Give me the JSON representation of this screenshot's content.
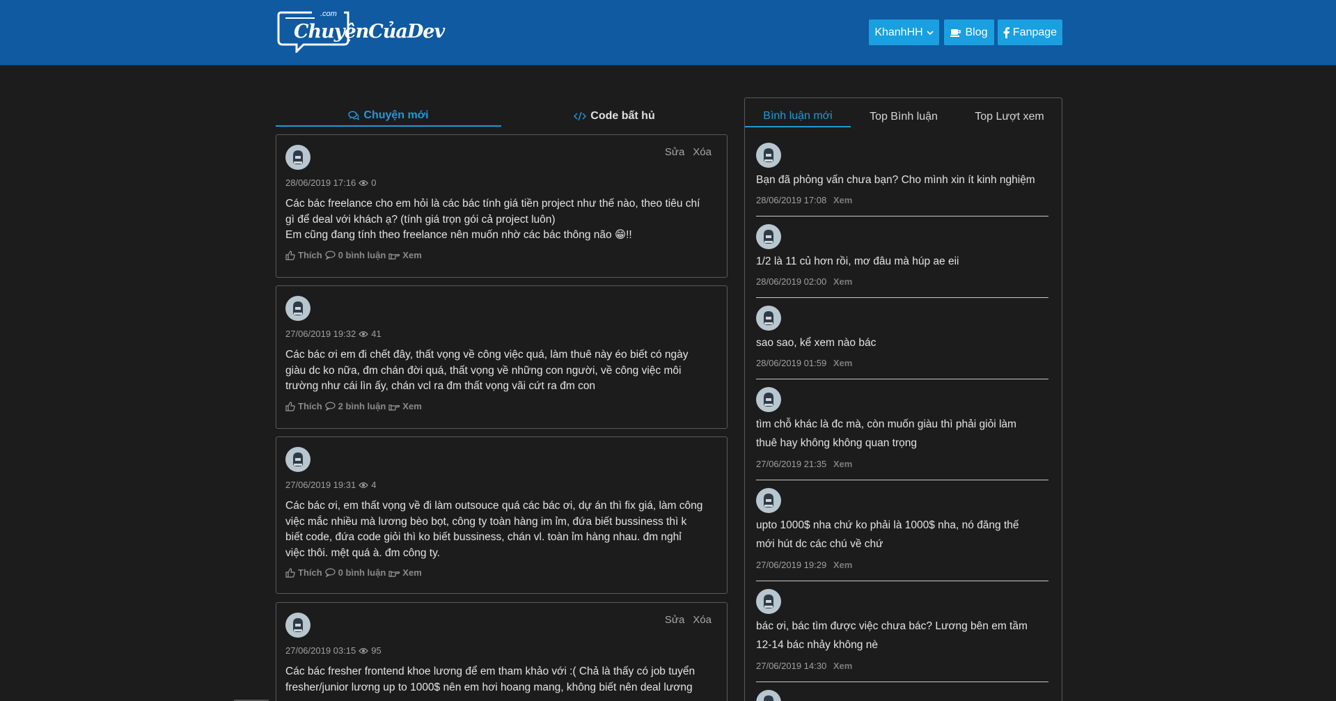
{
  "header": {
    "logo_com": ".com",
    "logo_text": "ChuyệnCủaDev",
    "user_label": "KhanhHH",
    "blog_label": "Blog",
    "fanpage_label": "Fanpage",
    "colors": {
      "bar": "#0f5aa0",
      "button": "#1aa0e0"
    }
  },
  "left_tabs": [
    {
      "label": "Chuyện mới",
      "icon": "comments-icon",
      "active": true
    },
    {
      "label": "Code bất hủ",
      "icon": "code-icon",
      "active": false
    }
  ],
  "posts": [
    {
      "edit": "Sửa",
      "delete": "Xóa",
      "time": "28/06/2019 17:16",
      "views": "0",
      "lines": [
        "Các bác freelance cho em hỏi là các bác tính giá tiền project như thế nào, theo tiêu chí",
        "gì để deal với khách ạ? (tính giá trọn gói cả project luôn)",
        "Em cũng đang tính theo freelance nên muốn nhờ các bác thông não 😁!!"
      ],
      "like": "Thích",
      "comments": "0 bình luận",
      "view_link": "Xem"
    },
    {
      "time": "27/06/2019 19:32",
      "views": "41",
      "lines": [
        "Các bác ơi em đi chết đây, thất vọng về công việc quá, làm thuê này éo biết có ngày",
        "giàu dc ko nữa, đm chán đời quá, thất vọng về những con người, về công việc môi",
        "trường như cái lìn ấy, chán vcl ra đm thất vọng vãi cứt ra đm con"
      ],
      "like": "Thích",
      "comments": "2 bình luận",
      "view_link": "Xem"
    },
    {
      "time": "27/06/2019 19:31",
      "views": "4",
      "lines": [
        "Các bác ơi, em thất vọng về đi làm outsouce quá các bác ơi, dự án thì fix giá, làm công",
        "việc mắc nhiều mà lương bèo bọt, công ty toàn hàng im ỉm, đứa biết bussiness thì k",
        "biết code, đứa code giỏi thì ko biết bussiness, chán vl. toàn ỉm hàng nhau. đm nghỉ",
        "việc thôi. mệt quá à. đm công ty."
      ],
      "like": "Thích",
      "comments": "0 bình luận",
      "view_link": "Xem"
    },
    {
      "edit": "Sửa",
      "delete": "Xóa",
      "time": "27/06/2019 03:15",
      "views": "95",
      "lines": [
        "Các bác fresher frontend khoe lương để em tham khảo với :( Chả là thấy có job tuyển",
        "fresher/junior lương up to 1000$ nên em hơi hoang mang, không biết nên deal lương"
      ]
    }
  ],
  "right_tabs": [
    "Bình luận mới",
    "Top Bình luận",
    "Top Lượt xem"
  ],
  "comments": [
    {
      "lines": [
        "Bạn đã phỏng vấn chưa bạn? Cho mình xin ít kinh nghiệm"
      ],
      "time": "28/06/2019 17:08",
      "xem": "Xem"
    },
    {
      "lines": [
        "1/2 là 11 củ hơn rồi, mơ đâu mà húp ae eii"
      ],
      "time": "28/06/2019 02:00",
      "xem": "Xem"
    },
    {
      "lines": [
        "sao sao, kể xem nào bác"
      ],
      "time": "28/06/2019 01:59",
      "xem": "Xem"
    },
    {
      "lines": [
        "tìm chỗ khác là đc mà, còn muốn giàu thì phải giỏi làm",
        "thuê hay không không quan trọng"
      ],
      "time": "27/06/2019 21:35",
      "xem": "Xem"
    },
    {
      "lines": [
        "upto 1000$ nha chứ ko phải là 1000$ nha, nó đăng thế",
        "mới hút dc các chú về chứ"
      ],
      "time": "27/06/2019 19:29",
      "xem": "Xem"
    },
    {
      "lines": [
        "bác ơi, bác tìm được việc chưa bác? Lương bên em tầm",
        "12-14 bác nhảy không nè"
      ],
      "time": "27/06/2019 14:30",
      "xem": "Xem"
    }
  ]
}
